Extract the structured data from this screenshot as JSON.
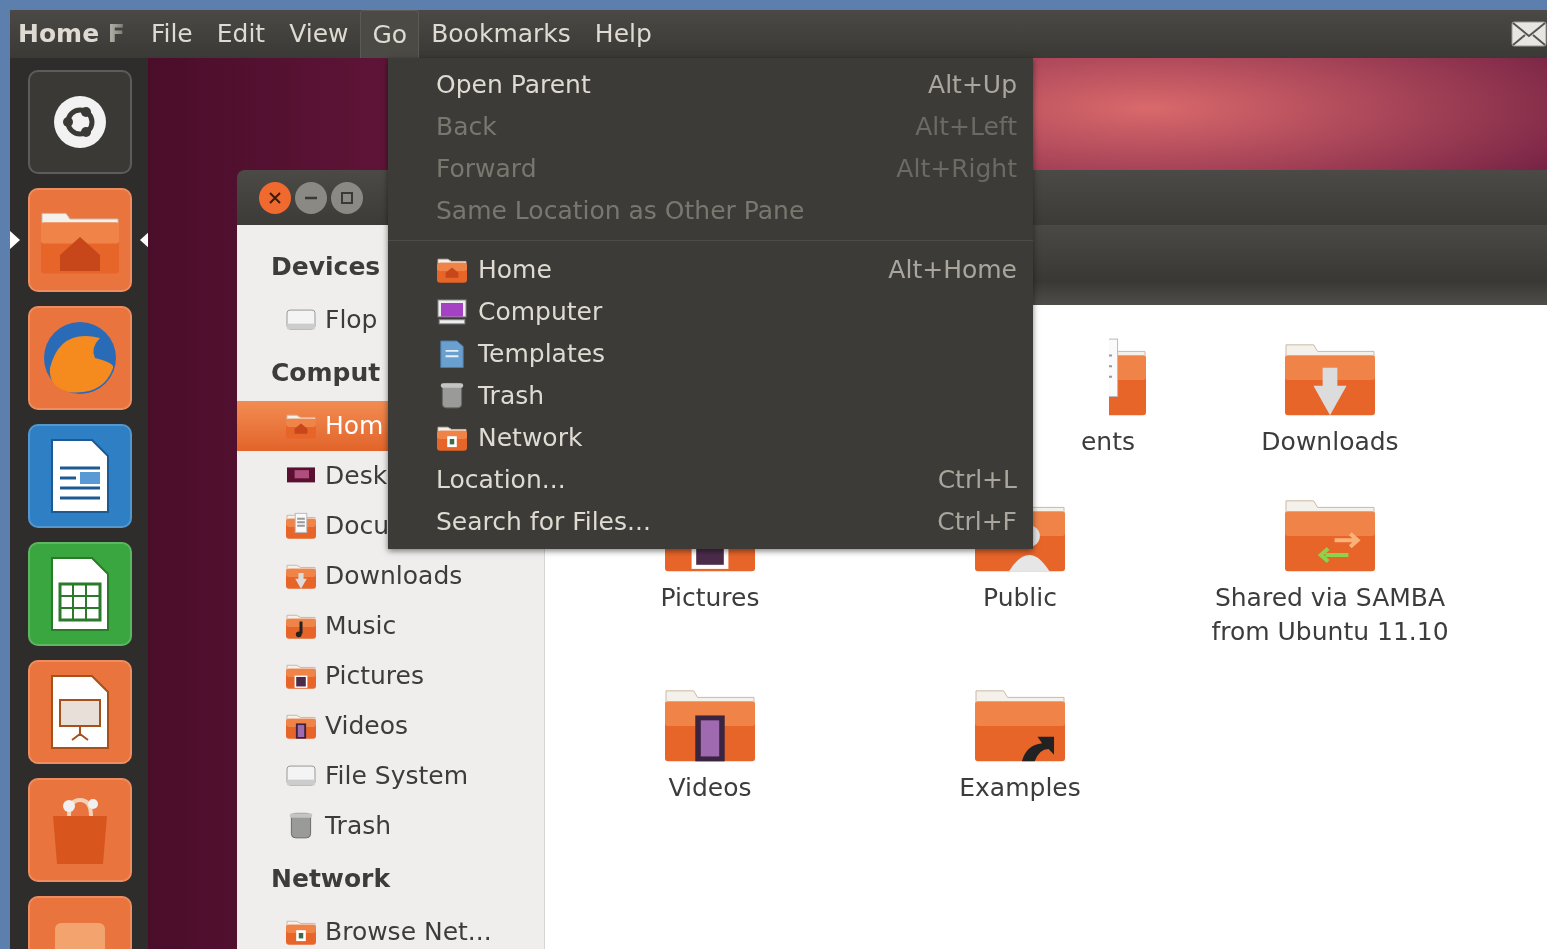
{
  "panel": {
    "title": "Home F",
    "menus": [
      {
        "label": "File",
        "selected": false
      },
      {
        "label": "Edit",
        "selected": false
      },
      {
        "label": "View",
        "selected": false
      },
      {
        "label": "Go",
        "selected": true
      },
      {
        "label": "Bookmarks",
        "selected": false
      },
      {
        "label": "Help",
        "selected": false
      }
    ]
  },
  "launcher": [
    {
      "kind": "dash",
      "running": false,
      "focused": false
    },
    {
      "kind": "files",
      "running": true,
      "focused": true
    },
    {
      "kind": "browser",
      "running": false,
      "focused": false
    },
    {
      "kind": "writer",
      "running": false,
      "focused": false
    },
    {
      "kind": "calc",
      "running": false,
      "focused": false
    },
    {
      "kind": "impress",
      "running": false,
      "focused": false
    },
    {
      "kind": "store",
      "running": false,
      "focused": false
    },
    {
      "kind": "other",
      "running": false,
      "focused": false
    }
  ],
  "sidebar": {
    "sections": [
      {
        "heading": "Devices",
        "items": [
          {
            "label": "Flop",
            "kind": "drive",
            "selected": false
          }
        ]
      },
      {
        "heading": "Comput",
        "items": [
          {
            "label": "Hom",
            "kind": "home",
            "selected": true
          },
          {
            "label": "Desk",
            "kind": "desktop",
            "selected": false
          },
          {
            "label": "Docu",
            "kind": "documents",
            "selected": false
          },
          {
            "label": "Downloads",
            "kind": "downloads",
            "selected": false
          },
          {
            "label": "Music",
            "kind": "music",
            "selected": false
          },
          {
            "label": "Pictures",
            "kind": "pictures",
            "selected": false
          },
          {
            "label": "Videos",
            "kind": "videos",
            "selected": false
          },
          {
            "label": "File System",
            "kind": "drive",
            "selected": false
          },
          {
            "label": "Trash",
            "kind": "trash",
            "selected": false
          }
        ]
      },
      {
        "heading": "Network",
        "items": [
          {
            "label": "Browse Net...",
            "kind": "network",
            "selected": false
          }
        ]
      }
    ]
  },
  "files": [
    {
      "label": "ents",
      "kind": "documents",
      "covered": true
    },
    {
      "label": "Downloads",
      "kind": "downloads",
      "covered": false
    },
    {
      "label": "Pictures",
      "kind": "pictures",
      "covered": false
    },
    {
      "label": "Public",
      "kind": "public",
      "covered": false
    },
    {
      "label": "Shared via SAMBA from Ubuntu 11.10",
      "kind": "shared",
      "covered": false
    },
    {
      "label": "Videos",
      "kind": "videos",
      "covered": false
    },
    {
      "label": "Examples",
      "kind": "link",
      "covered": false
    }
  ],
  "go_menu": {
    "items": [
      {
        "kind": "action",
        "label": "Open Parent",
        "shortcut": "Alt+Up",
        "disabled": false
      },
      {
        "kind": "action",
        "label": "Back",
        "shortcut": "Alt+Left",
        "disabled": true
      },
      {
        "kind": "action",
        "label": "Forward",
        "shortcut": "Alt+Right",
        "disabled": true
      },
      {
        "kind": "action",
        "label": "Same Location as Other Pane",
        "disabled": true
      },
      {
        "kind": "separator"
      },
      {
        "kind": "home",
        "label": "Home",
        "shortcut": "Alt+Home",
        "disabled": false
      },
      {
        "kind": "computer",
        "label": "Computer",
        "disabled": false
      },
      {
        "kind": "templates",
        "label": "Templates",
        "disabled": false
      },
      {
        "kind": "trash",
        "label": "Trash",
        "disabled": false
      },
      {
        "kind": "network",
        "label": "Network",
        "disabled": false
      },
      {
        "kind": "action",
        "label": "Location...",
        "shortcut": "Ctrl+L",
        "disabled": false
      },
      {
        "kind": "action",
        "label": "Search for Files...",
        "shortcut": "Ctrl+F",
        "disabled": false
      }
    ]
  }
}
